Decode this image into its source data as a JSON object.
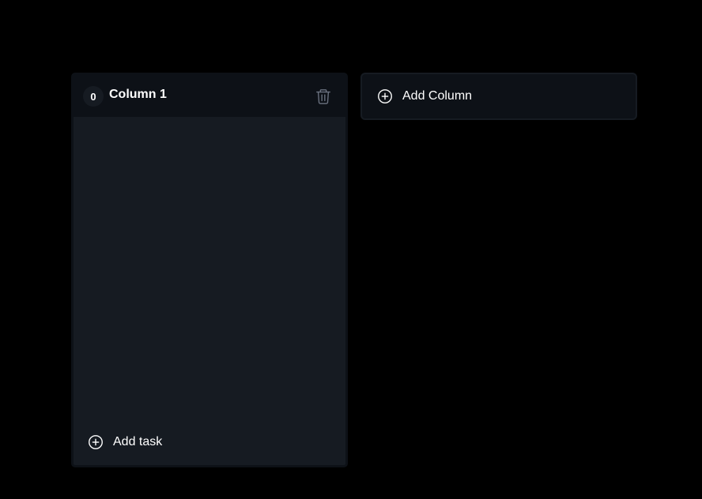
{
  "board": {
    "columns": [
      {
        "task_count": "0",
        "title": "Column 1",
        "add_task_label": "Add task"
      }
    ],
    "add_column_label": "Add Column"
  },
  "icons": {
    "delete": "trash-icon",
    "add_task": "plus-circle-icon",
    "add_column": "plus-circle-icon"
  },
  "colors": {
    "background": "#000000",
    "column_bg": "#161b22",
    "header_bg": "#0d1117",
    "text": "#ffffff",
    "muted_icon": "#6b7280"
  }
}
